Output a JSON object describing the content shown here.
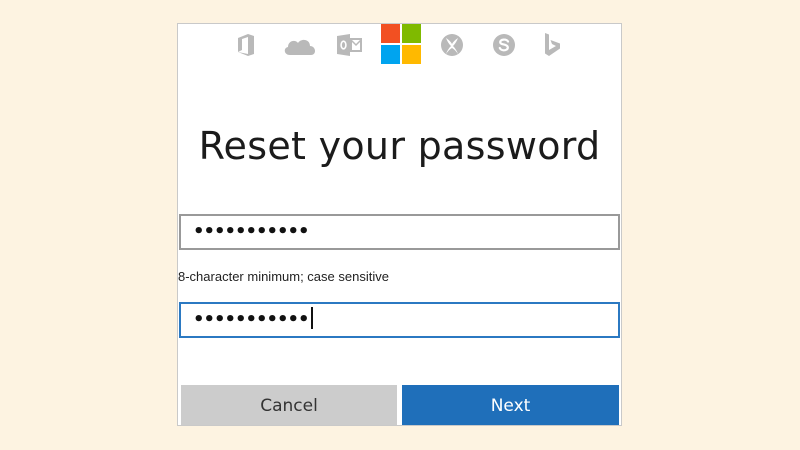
{
  "brand_icons": [
    {
      "name": "office-icon"
    },
    {
      "name": "onedrive-icon"
    },
    {
      "name": "outlook-icon"
    },
    {
      "name": "microsoft-logo"
    },
    {
      "name": "xbox-icon"
    },
    {
      "name": "skype-icon"
    },
    {
      "name": "bing-icon"
    }
  ],
  "colors": {
    "page_background": "#fdf3e1",
    "icon_gray": "#b9b9b9",
    "ms_red": "#f25022",
    "ms_green": "#7fba00",
    "ms_blue": "#00a4ef",
    "ms_yellow": "#ffb900",
    "focus_border": "#2b79c2",
    "primary_button": "#1f6fba",
    "secondary_button": "#cccccc"
  },
  "form": {
    "title": "Reset your password",
    "new_password_value": "•••••••••••",
    "hint": "8-character minimum; case sensitive",
    "confirm_password_value": "•••••••••••"
  },
  "buttons": {
    "cancel_label": "Cancel",
    "next_label": "Next"
  }
}
